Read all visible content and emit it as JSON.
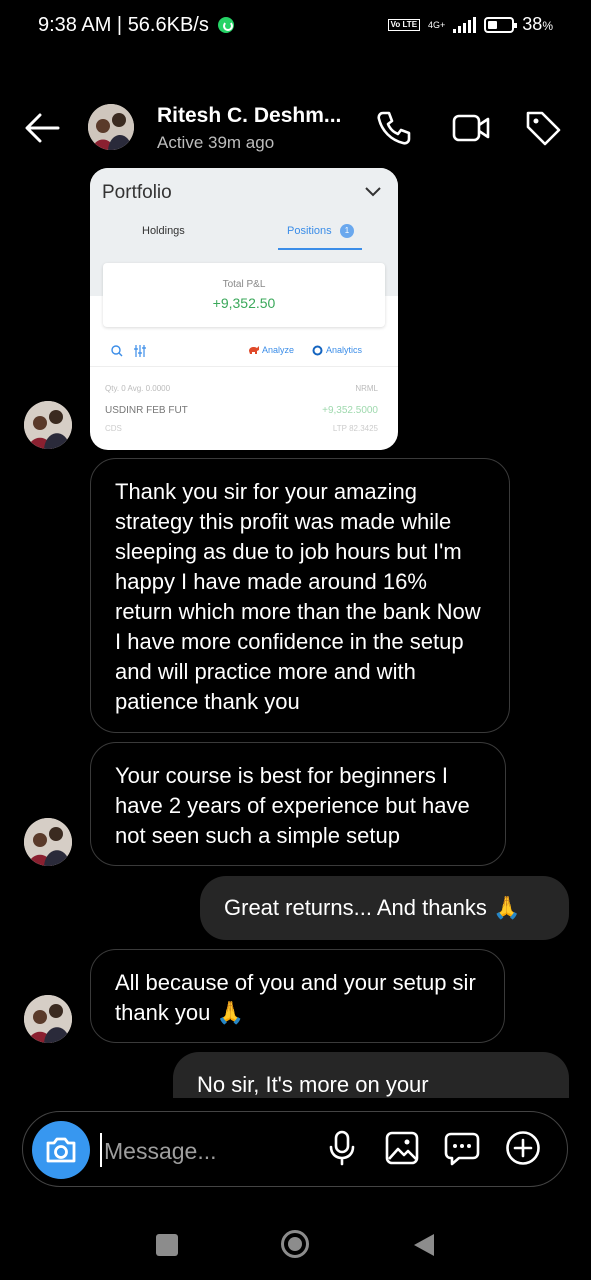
{
  "status_bar": {
    "time_speed": "9:38 AM | 56.6KB/s",
    "volte": "Vo LTE",
    "network": "4G+",
    "battery_percent": 38,
    "battery_text": "38",
    "battery_suffix": "%"
  },
  "header": {
    "contact_name": "Ritesh C. Deshm...",
    "active_status": "Active 39m ago"
  },
  "portfolio_card": {
    "title": "Portfolio",
    "tab_holdings": "Holdings",
    "tab_positions": "Positions",
    "positions_count": "1",
    "total_pnl_label": "Total P&L",
    "total_pnl_value": "+9,352.50",
    "analyze_label": "Analyze",
    "analytics_label": "Analytics",
    "position": {
      "qty_avg": "Qty. 0   Avg. 0.0000",
      "product": "NRML",
      "instrument": "USDINR FEB FUT",
      "pnl": "+9,352.5000",
      "exchange": "CDS",
      "ltp": "LTP 82.3425"
    }
  },
  "messages": [
    {
      "direction": "incoming",
      "text": "Thank you sir for your amazing strategy this profit was made while sleeping as due to job hours but I'm happy I have made around 16% return which more than the bank Now I have more confidence in the setup and will practice more and with patience thank you"
    },
    {
      "direction": "incoming",
      "text": "Your course is best for beginners I have 2 years of experience but have not seen such a simple setup"
    },
    {
      "direction": "outgoing",
      "text": "Great returns... And thanks 🙏"
    },
    {
      "direction": "incoming",
      "text": "All because of you and your setup sir thank you 🙏"
    },
    {
      "direction": "outgoing",
      "text": "No sir, It's more on your"
    }
  ],
  "composer": {
    "placeholder": "Message..."
  },
  "icons": {
    "back": "back-arrow-icon",
    "call": "phone-icon",
    "video": "video-camera-icon",
    "tag": "tag-icon",
    "camera": "camera-icon",
    "mic": "microphone-icon",
    "gallery": "image-icon",
    "sticker": "chat-bubble-icon",
    "add": "plus-circle-icon"
  },
  "colors": {
    "accent": "#3797f0",
    "profit_green": "#3aa85a",
    "whatsapp_green": "#25d366"
  }
}
